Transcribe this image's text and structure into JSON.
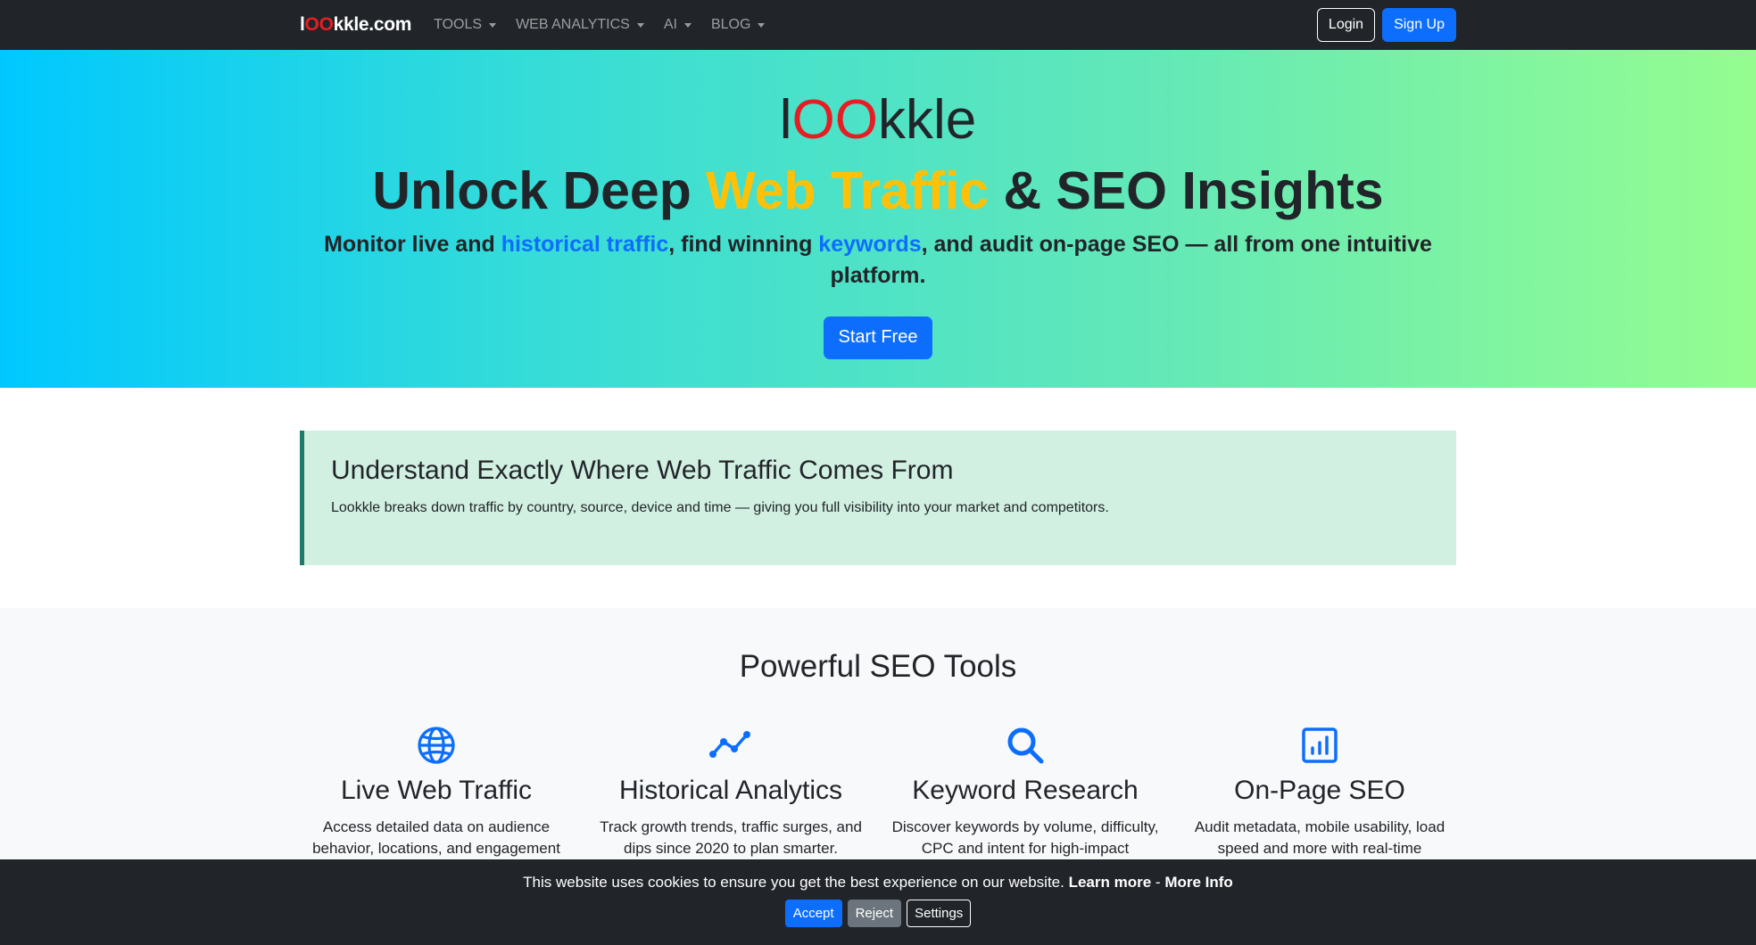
{
  "navbar": {
    "brand": {
      "part1": "l",
      "part2": "OO",
      "part3": "kkle.com"
    },
    "menu": [
      {
        "label": "TOOLS"
      },
      {
        "label": "WEB ANALYTICS"
      },
      {
        "label": "AI"
      },
      {
        "label": "BLOG"
      }
    ],
    "login_label": "Login",
    "signup_label": "Sign Up"
  },
  "hero": {
    "logo": {
      "part1": "l",
      "part2": "OO",
      "part3": "kkle"
    },
    "title": {
      "part1": "Unlock Deep ",
      "highlight": "Web Traffic",
      "part2": " & SEO Insights"
    },
    "subtitle": {
      "part1": "Monitor live and ",
      "link1": "historical traffic",
      "part2": ", find winning ",
      "link2": "keywords",
      "part3": ", and audit on-page SEO — all from one intuitive platform."
    },
    "cta_label": "Start Free"
  },
  "callout": {
    "title": "Understand Exactly Where Web Traffic Comes From",
    "text": "Lookkle breaks down traffic by country, source, device and time — giving you full visibility into your market and competitors."
  },
  "tools": {
    "title": "Powerful SEO Tools",
    "items": [
      {
        "icon": "globe-icon",
        "title": "Live Web Traffic",
        "desc": "Access detailed data on audience behavior, locations, and engagement"
      },
      {
        "icon": "graph-up-icon",
        "title": "Historical Analytics",
        "desc": "Track growth trends, traffic surges, and dips since 2020 to plan smarter."
      },
      {
        "icon": "search-icon",
        "title": "Keyword Research",
        "desc": "Discover keywords by volume, difficulty, CPC and intent for high-impact"
      },
      {
        "icon": "bar-chart-icon",
        "title": "On-Page SEO",
        "desc": "Audit metadata, mobile usability, load speed and more with real-time"
      }
    ]
  },
  "cookie": {
    "text": "This website uses cookies to ensure you get the best experience on our website.",
    "learn_more": "Learn more",
    "separator": "-",
    "more_info": "More Info",
    "accept_label": "Accept",
    "reject_label": "Reject",
    "settings_label": "Settings"
  },
  "colors": {
    "accent": "#0d6efd",
    "brand_red": "#e61e24",
    "highlight_yellow": "#ffc107",
    "callout_border": "#1f7a68"
  }
}
